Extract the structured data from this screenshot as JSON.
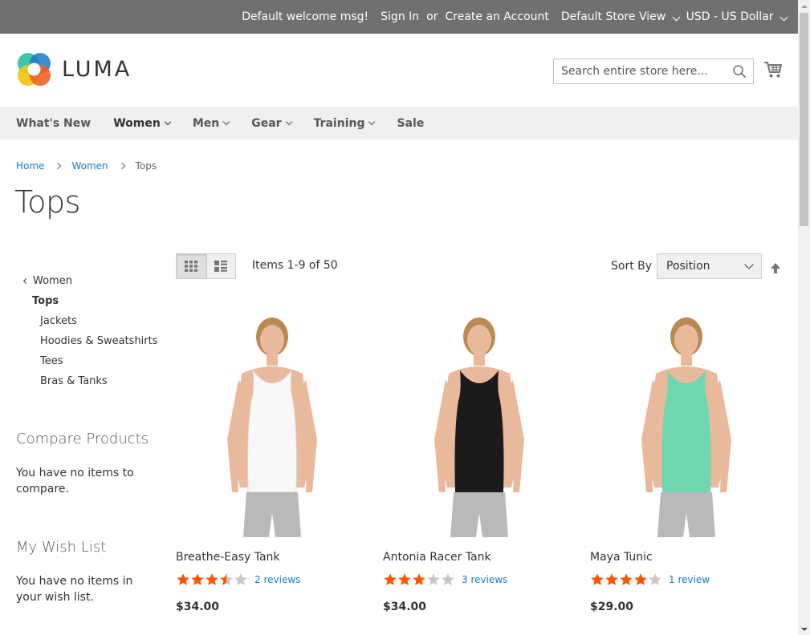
{
  "top_bar": {
    "welcome": "Default welcome msg!",
    "sign_in": "Sign In",
    "or": "or",
    "create_account": "Create an Account",
    "store_view": "Default Store View",
    "currency": "USD - US Dollar"
  },
  "header": {
    "logo_text": "LUMA",
    "search_placeholder": "Search entire store here...",
    "search_value": ""
  },
  "nav": {
    "items": [
      {
        "label": "What's New"
      },
      {
        "label": "Women"
      },
      {
        "label": "Men"
      },
      {
        "label": "Gear"
      },
      {
        "label": "Training"
      },
      {
        "label": "Sale"
      }
    ]
  },
  "breadcrumb": {
    "items": [
      "Home",
      "Women",
      "Tops"
    ]
  },
  "page_title": "Tops",
  "sidebar": {
    "back_label": "Women",
    "current": "Tops",
    "subcategories": [
      "Jackets",
      "Hoodies & Sweatshirts",
      "Tees",
      "Bras & Tanks"
    ],
    "compare": {
      "title": "Compare Products",
      "empty_text": "You have no items to compare."
    },
    "wishlist": {
      "title": "My Wish List",
      "empty_text": "You have no items in your wish list."
    }
  },
  "toolbar": {
    "amount": "Items 1-9 of 50",
    "sort_label": "Sort By",
    "sort_value": "Position"
  },
  "products": [
    {
      "name": "Breathe-Easy Tank",
      "rating": 3.5,
      "reviews": "2 reviews",
      "price": "$34.00",
      "top_color": "#f8f8f8"
    },
    {
      "name": "Antonia Racer Tank",
      "rating": 3,
      "reviews": "3 reviews",
      "price": "$34.00",
      "top_color": "#1b1b1b"
    },
    {
      "name": "Maya Tunic",
      "rating": 4,
      "reviews": "1 review",
      "price": "$29.00",
      "top_color": "#6fd7b0"
    }
  ],
  "colors": {
    "top_bar": "#6e716e",
    "nav_bg": "#f0f0f0",
    "link": "#1979c3",
    "star": "#ff5501",
    "star_empty": "#c7c7c7"
  }
}
